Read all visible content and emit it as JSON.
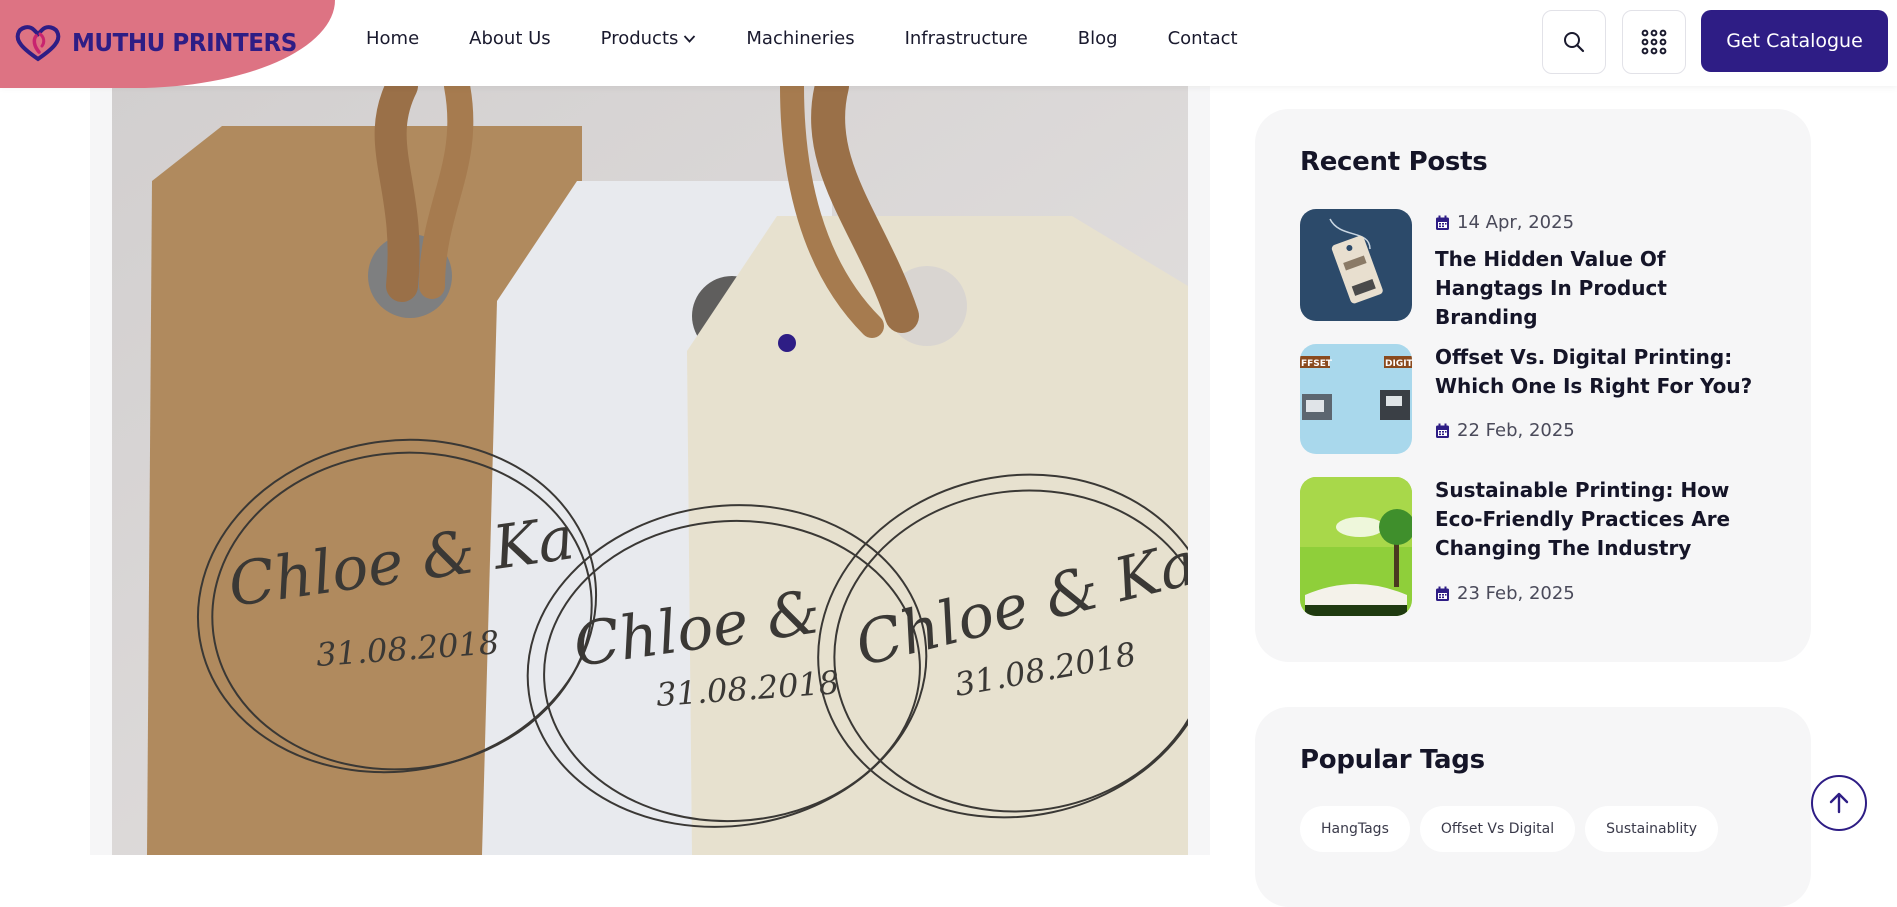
{
  "brand": {
    "name": "MUTHU PRINTERS",
    "accent": "#2e1d85",
    "logo_bg": "#dd7383"
  },
  "nav": {
    "items": [
      {
        "label": "Home"
      },
      {
        "label": "About Us"
      },
      {
        "label": "Products",
        "has_dropdown": true
      },
      {
        "label": "Machineries"
      },
      {
        "label": "Infrastructure"
      },
      {
        "label": "Blog"
      },
      {
        "label": "Contact"
      }
    ],
    "search_icon": "search-icon",
    "menu_icon": "grid-menu-icon",
    "cta_label": "Get Catalogue"
  },
  "hero": {
    "image_subject": "kraft, white and cream gift hang tags with twine",
    "tags_text": [
      {
        "names": "Chloe & Ka",
        "date": "31.08.2018"
      },
      {
        "names": "Chloe & ",
        "date": "31.08.2018"
      },
      {
        "names": "Chloe & Karl",
        "date": "31.08.2018"
      }
    ]
  },
  "sidebar": {
    "recent_title": "Recent Posts",
    "posts": [
      {
        "date": "14 Apr, 2025",
        "title": "The Hidden Value Of Hangtags In Product Branding",
        "thumb": "hangtag"
      },
      {
        "date": "22 Feb, 2025",
        "title": "Offset Vs. Digital Printing: Which One Is Right For You?",
        "thumb": "offset-digital",
        "thumb_labels": [
          "FFSET",
          "DIGIT"
        ]
      },
      {
        "date": "23 Feb, 2025",
        "title": "Sustainable Printing: How Eco-Friendly Practices Are Changing The Industry",
        "thumb": "eco"
      }
    ],
    "popular_title": "Popular Tags",
    "tags": [
      "HangTags",
      "Offset Vs Digital",
      "Sustainablity"
    ]
  },
  "scroll_top_icon": "arrow-up-icon"
}
